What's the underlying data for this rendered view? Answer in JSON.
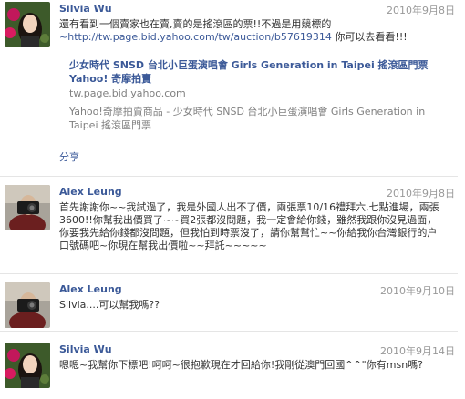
{
  "posts": [
    {
      "author": "Silvia Wu",
      "time": "2010年9月8日",
      "body_pre": "還有看到一個賣家也在賣,賣的是搖滾區的票!!不過是用競標的",
      "link": "~http://tw.page.bid.yahoo.com/tw/auction/b57619314",
      "body_post": " 你可以去看看!!!",
      "attachment": {
        "title": "少女時代 SNSD 台北小巨蛋演唱會 Girls Generation in Taipei 搖滾區門票 Yahoo! 奇摩拍賣",
        "host": "tw.page.bid.yahoo.com",
        "description": "Yahoo!奇摩拍賣商品 - 少女時代 SNSD 台北小巨蛋演唱會 Girls Generation in Taipei 搖滾區門票"
      },
      "share_label": "分享"
    },
    {
      "author": "Alex Leung",
      "time": "2010年9月8日",
      "body": "首先謝謝你~~我試過了，我是外國人出不了價，兩張票10/16禮拜六,七點進場，兩張3600!!你幫我出價買了~~買2張都沒問題，我一定會給你錢，雖然我跟你沒見過面，你要我先給你錢都沒問題，但我怕到時票沒了，請你幫幫忙~~你給我你台灣銀行的户口號碼吧~你現在幫我出價啦~~拜託~~~~~"
    },
    {
      "author": "Alex Leung",
      "time": "2010年9月10日",
      "body": "Silvia....可以幫我嗎??"
    },
    {
      "author": "Silvia Wu",
      "time": "2010年9月14日",
      "body": "嗯嗯~我幫你下標吧!呵呵~很抱歉現在才回給你!我剛從澳門回國^^\"你有msn嗎?"
    }
  ],
  "icons": {
    "avatar_female": "profile-photo-silvia",
    "avatar_male": "profile-photo-alex",
    "delete": "×"
  }
}
